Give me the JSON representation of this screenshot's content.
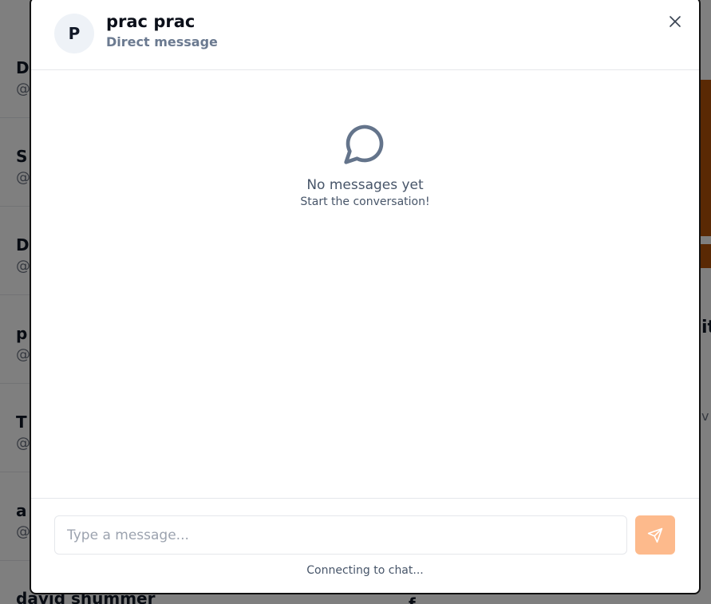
{
  "background": {
    "list_items": [
      {
        "name": "D",
        "handle": "@"
      },
      {
        "name": "S",
        "handle": "@"
      },
      {
        "name": "D",
        "handle": "@"
      },
      {
        "name": "p",
        "handle": "@"
      },
      {
        "name": "T",
        "handle": "@"
      },
      {
        "name": "a",
        "handle": "@"
      }
    ],
    "bottom_name": "david shummer",
    "bottom_right": "f",
    "right_texts": [
      "it",
      "v"
    ]
  },
  "modal": {
    "avatar_initial": "P",
    "name": "prac prac",
    "subtitle": "Direct message",
    "close_icon": "close-icon",
    "empty_state": {
      "icon": "chat-bubble-icon",
      "title": "No messages yet",
      "subtitle": "Start the conversation!"
    },
    "composer": {
      "placeholder": "Type a message...",
      "value": "",
      "send_icon": "send-icon",
      "status": "Connecting to chat..."
    }
  },
  "colors": {
    "accent_send_disabled": "#fdba8c",
    "muted_text": "#6b7a90",
    "icon_stroke": "#64748b"
  }
}
